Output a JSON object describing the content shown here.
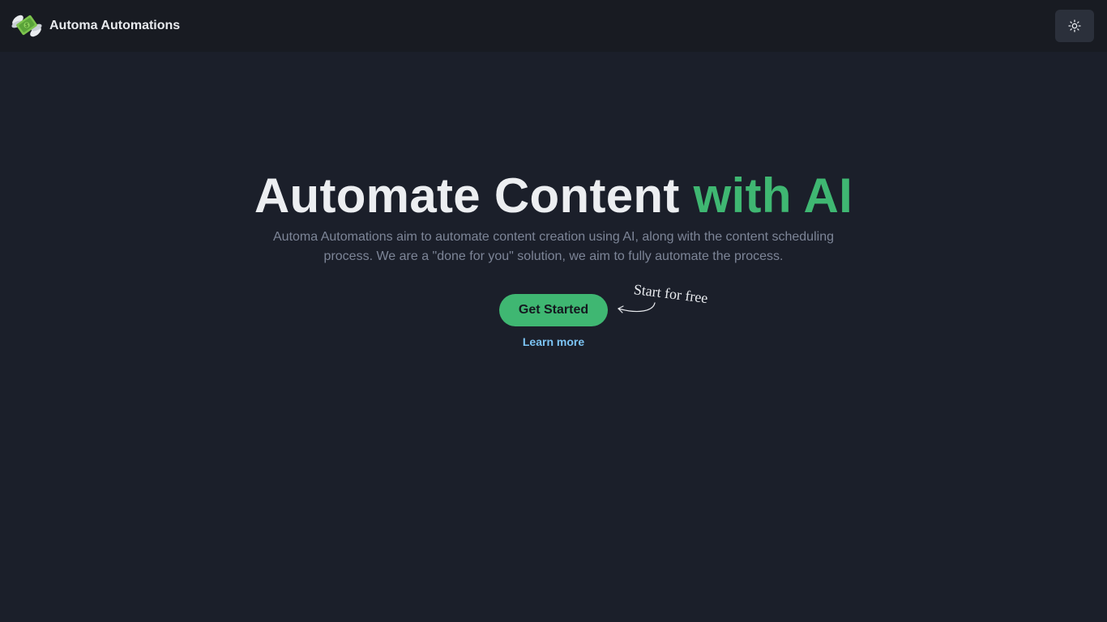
{
  "header": {
    "brand_name": "Automa Automations",
    "logo_icon": "money-with-wings-icon",
    "theme_toggle_icon": "sun-icon"
  },
  "hero": {
    "title_main": "Automate Content ",
    "title_accent": "with AI",
    "description": "Automa Automations aim to automate content creation using AI, along with the content scheduling process. We are a \"done for you\" solution, we aim to fully automate the process.",
    "cta_label": "Get Started",
    "cta_note": "Start for free",
    "learn_more_label": "Learn more"
  },
  "colors": {
    "background": "#1b1f2a",
    "header_background": "#181b22",
    "accent_green": "#3fb772",
    "link_blue": "#7cc4f4",
    "muted_text": "#7d8597"
  }
}
